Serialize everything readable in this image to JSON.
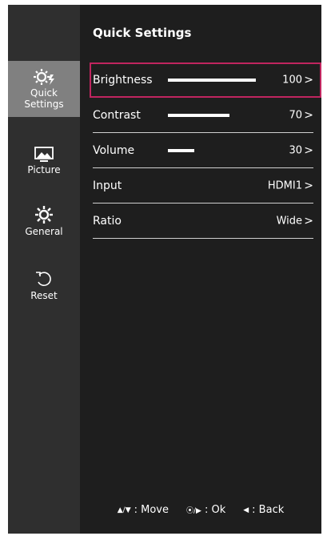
{
  "sidebar": {
    "items": [
      {
        "label": "Quick\nSettings",
        "icon": "quick-settings-icon",
        "active": true
      },
      {
        "label": "Picture",
        "icon": "picture-icon",
        "active": false
      },
      {
        "label": "General",
        "icon": "gear-icon",
        "active": false
      },
      {
        "label": "Reset",
        "icon": "reset-icon",
        "active": false
      }
    ]
  },
  "main": {
    "title": "Quick Settings",
    "rows": [
      {
        "label": "Brightness",
        "value": "100",
        "level": 100,
        "selected": true
      },
      {
        "label": "Contrast",
        "value": "70",
        "level": 70,
        "selected": false
      },
      {
        "label": "Volume",
        "value": "30",
        "level": 30,
        "selected": false
      },
      {
        "label": "Input",
        "value": "HDMI1",
        "selected": false
      },
      {
        "label": "Ratio",
        "value": "Wide",
        "selected": false
      }
    ],
    "chevron": ">"
  },
  "footer": {
    "move": {
      "symbols": "▲/▼",
      "label": ": Move"
    },
    "ok": {
      "symbols": "⦿/▶",
      "label": ": Ok"
    },
    "back": {
      "symbols": "◀",
      "label": ": Back"
    }
  },
  "colors": {
    "background": "#1e1e1e",
    "sidebar": "#2f2f2f",
    "sidebar_active": "#808080",
    "highlight": "#c0255f"
  }
}
